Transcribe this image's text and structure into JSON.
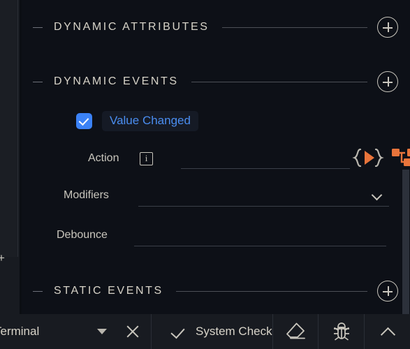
{
  "theme": {
    "panel_bg": "#0d1017",
    "toolbar_bg": "#181b21",
    "text": "#d7d3c8",
    "accent_blue": "#4a8df0",
    "accent_orange": "#e8743b",
    "rule": "#4c4f57",
    "scrollbar": "#2c313b"
  },
  "panel": {
    "sections": [
      {
        "title": "DYNAMIC ATTRIBUTES",
        "add_label": "+",
        "collapse_icon": "minus-icon"
      },
      {
        "title": "DYNAMIC EVENTS",
        "add_label": "+",
        "collapse_icon": "minus-icon"
      },
      {
        "title": "STATIC EVENTS",
        "add_label": "+",
        "collapse_icon": "minus-icon"
      }
    ],
    "event": {
      "checked": true,
      "name": "Value Changed"
    },
    "fields": [
      {
        "label": "Action",
        "value": "",
        "placeholder": "",
        "info_icon": "i",
        "has_info": true,
        "has_dropdown": false
      },
      {
        "label": "Modifiers",
        "value": "",
        "placeholder": "",
        "info_icon": "",
        "has_info": false,
        "has_dropdown": true
      },
      {
        "label": "Debounce",
        "value": "",
        "placeholder": "",
        "info_icon": "",
        "has_info": false,
        "has_dropdown": false
      }
    ],
    "action_icons": [
      {
        "name": "script-braces-play-icon",
        "color": "#e8743b"
      },
      {
        "name": "node-graph-icon",
        "color": "#e8743b"
      }
    ]
  },
  "toolbar": {
    "panel_tab": "Terminal",
    "dropdown_icon": "triangle-down-icon",
    "close_icon": "close-icon",
    "status_label": "System Check",
    "status_icon": "check-icon",
    "clear_icon": "eraser-icon",
    "debug_icon": "bug-icon",
    "collapse_icon": "chevron-up-icon"
  }
}
